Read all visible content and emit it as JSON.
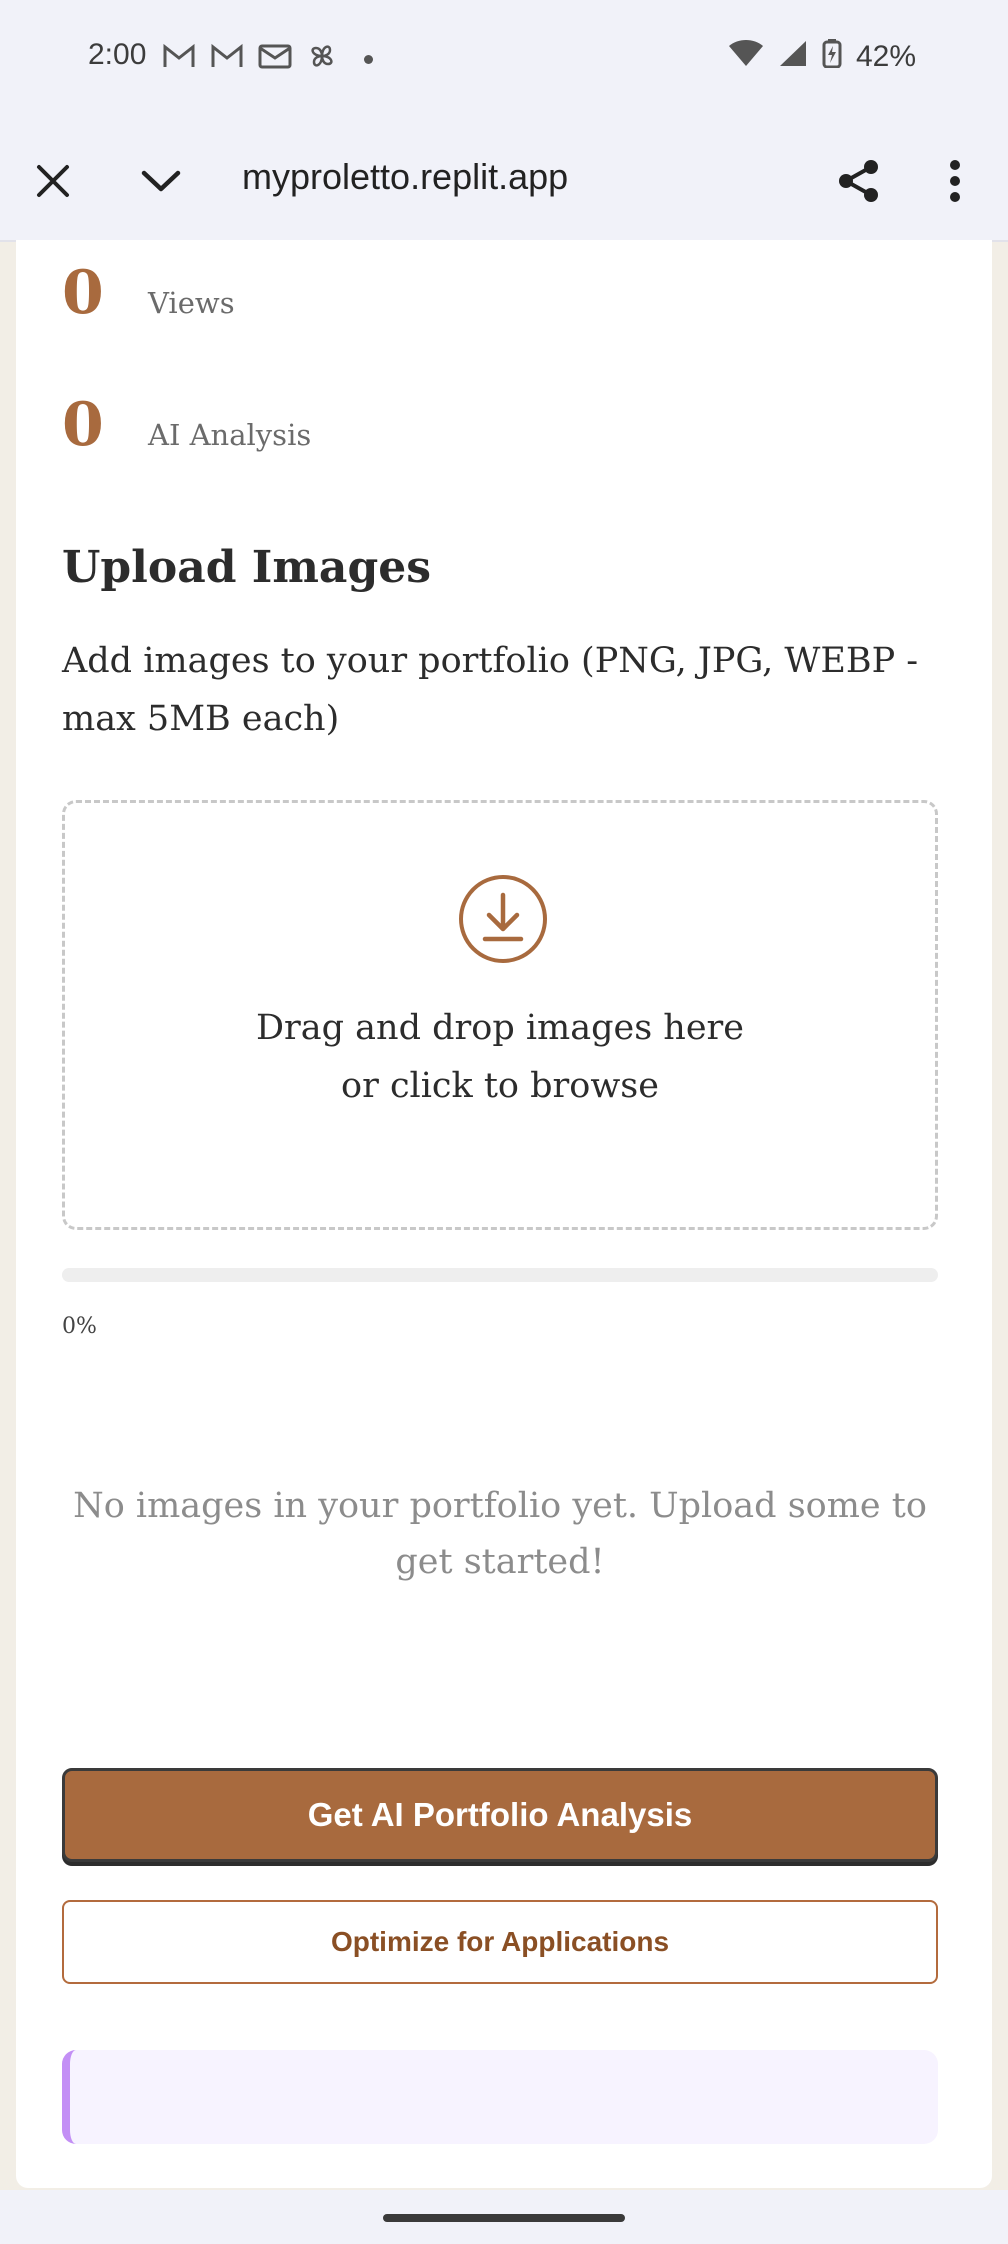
{
  "status_bar": {
    "time": "2:00",
    "battery": "42%",
    "icons_left": [
      "gmail-icon",
      "gmail-icon",
      "mail-icon",
      "pinwheel-icon",
      "dot"
    ],
    "icons_right": [
      "wifi-icon",
      "signal-icon",
      "battery-charging-icon"
    ]
  },
  "browser": {
    "url": "myproletto.replit.app",
    "icons": [
      "close-icon",
      "chevron-down-icon",
      "share-icon",
      "more-vert-icon"
    ]
  },
  "stats": [
    {
      "value": "0",
      "label": "Views"
    },
    {
      "value": "0",
      "label": "AI Analysis"
    }
  ],
  "upload": {
    "title": "Upload Images",
    "description": "Add images to your portfolio (PNG, JPG, WEBP - max 5MB each)",
    "dropzone_line1": "Drag and drop images here",
    "dropzone_line2": "or click to browse",
    "progress_value": 0,
    "progress_text": "0%"
  },
  "empty_state": "No images in your portfolio yet. Upload some to get started!",
  "buttons": {
    "primary": "Get AI Portfolio Analysis",
    "secondary": "Optimize for Applications"
  },
  "colors": {
    "accent": "#a86a3e",
    "callout_border": "#c38ff5",
    "callout_bg": "#f7f3ff"
  }
}
